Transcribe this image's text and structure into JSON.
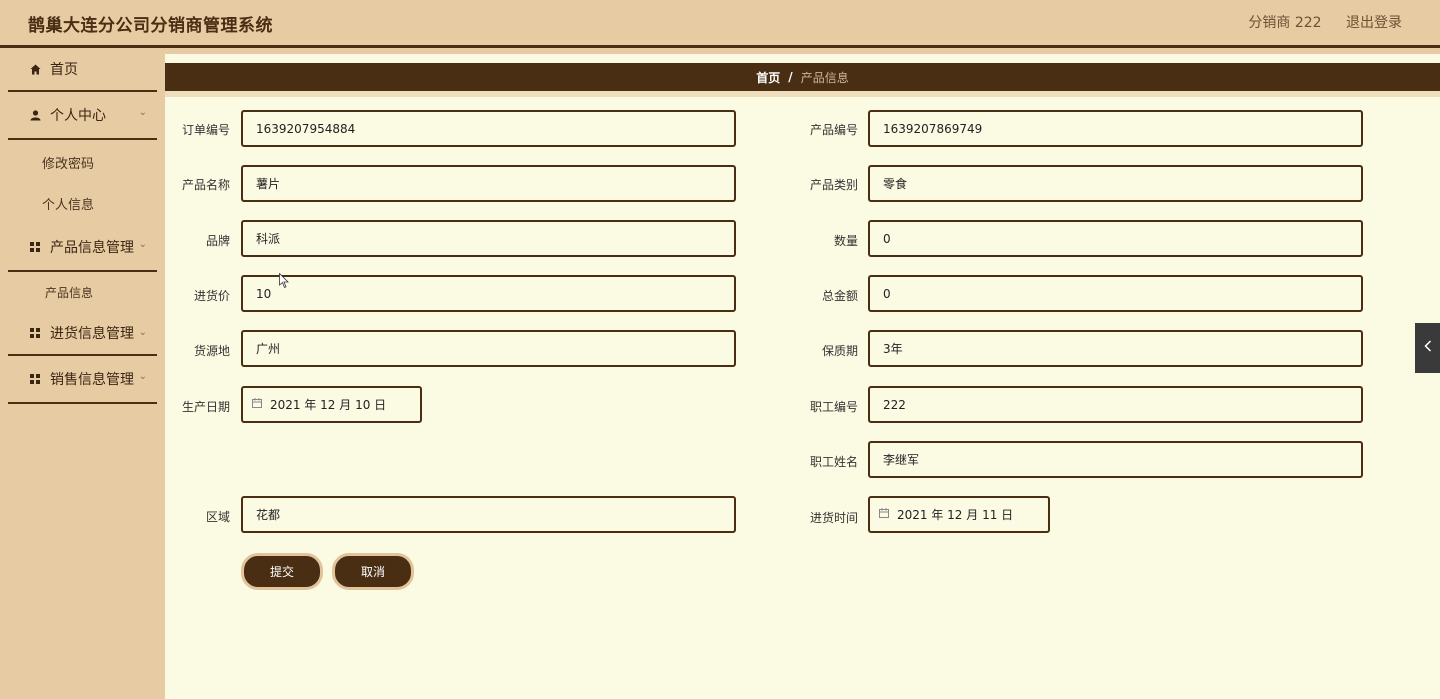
{
  "header": {
    "title": "鹊巢大连分公司分销商管理系统",
    "user": "分销商 222",
    "logout": "退出登录"
  },
  "sidebar": {
    "home": "首页",
    "personal_center": "个人中心",
    "change_password": "修改密码",
    "personal_info": "个人信息",
    "product_mgmt": "产品信息管理",
    "product_info": "产品信息",
    "purchase_mgmt": "进货信息管理",
    "sales_mgmt": "销售信息管理"
  },
  "breadcrumb": {
    "home": "首页",
    "separator": "/",
    "current": "产品信息"
  },
  "form": {
    "order_no": {
      "label": "订单编号",
      "value": "1639207954884"
    },
    "product_no": {
      "label": "产品编号",
      "value": "1639207869749"
    },
    "product_name": {
      "label": "产品名称",
      "value": "薯片"
    },
    "product_category": {
      "label": "产品类别",
      "value": "零食"
    },
    "brand": {
      "label": "品牌",
      "value": "科派"
    },
    "quantity": {
      "label": "数量",
      "value": "0"
    },
    "purchase_price": {
      "label": "进货价",
      "value": "10"
    },
    "total_amount": {
      "label": "总金额",
      "value": "0"
    },
    "origin": {
      "label": "货源地",
      "value": "广州"
    },
    "shelf_life": {
      "label": "保质期",
      "value": "3年"
    },
    "production_date": {
      "label": "生产日期",
      "value": "2021 年 12 月 10 日"
    },
    "employee_no": {
      "label": "职工编号",
      "value": "222"
    },
    "employee_name": {
      "label": "职工姓名",
      "value": "李继军"
    },
    "region": {
      "label": "区域",
      "value": "花都"
    },
    "purchase_time": {
      "label": "进货时间",
      "value": "2021 年 12 月 11 日"
    }
  },
  "buttons": {
    "submit": "提交",
    "cancel": "取消"
  },
  "icons": {
    "home": "home-icon",
    "user": "user-icon",
    "grid": "grid-icon",
    "chevron": "chevron-down-icon",
    "calendar": "calendar-icon",
    "collapse": "chevron-left-icon"
  },
  "colors": {
    "brand_dark": "#4a2e14",
    "sidebar_bg": "#e7cba2",
    "content_bg": "#fbfae3"
  }
}
